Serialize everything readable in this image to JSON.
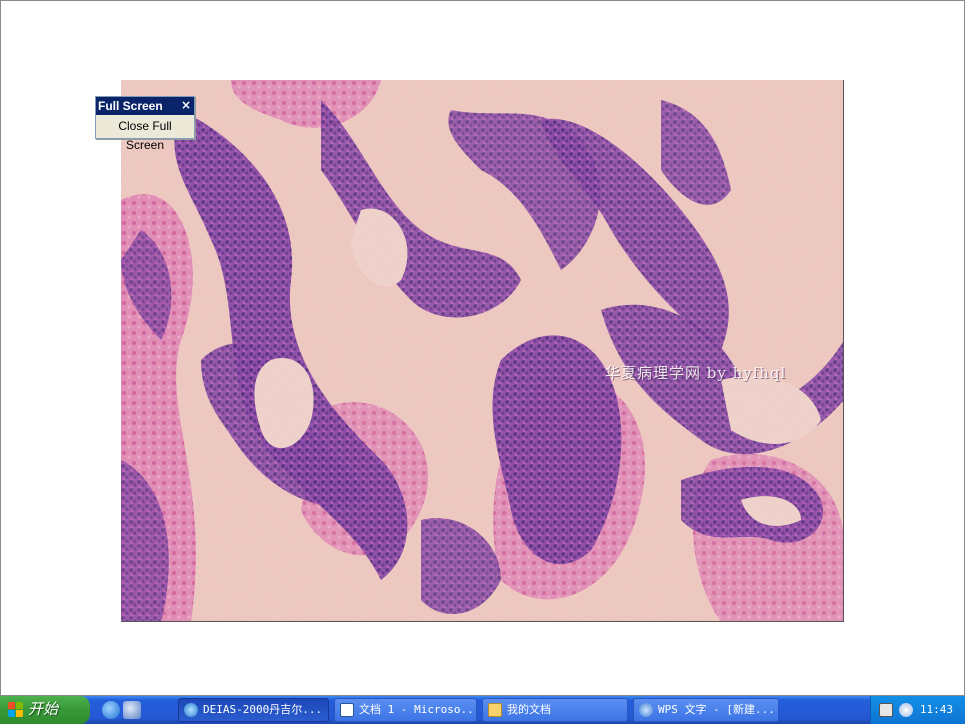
{
  "fullscreen_toolbar": {
    "title": "Full Screen",
    "close_glyph": "×",
    "close_button_label": "Close Full Screen"
  },
  "image": {
    "watermark": "华夏病理学网 by hyfhql",
    "description_icon": "histology-slide-image"
  },
  "taskbar": {
    "start_label": "开始",
    "quick_launch": [
      "ie-icon",
      "desktop-icon"
    ],
    "tasks": [
      {
        "label": "DEIAS-2000丹吉尔...",
        "icon": "app-icon",
        "active": true
      },
      {
        "label": "文档 1 - Microso...",
        "icon": "word-icon",
        "active": false
      },
      {
        "label": "我的文档",
        "icon": "folder-icon",
        "active": false
      },
      {
        "label": "WPS 文字 - [新建...",
        "icon": "wps-icon",
        "active": false
      }
    ],
    "tray_icons": [
      "keyboard-icon",
      "network-icon"
    ],
    "clock": "11:43"
  },
  "colors": {
    "taskbar_blue": "#245edb",
    "start_green": "#3a9a3a",
    "toolbar_title": "#0a246a",
    "tissue_purple": "#7a3f9e",
    "tissue_pink": "#e07ab0",
    "background_peach": "#f3d2c2"
  }
}
